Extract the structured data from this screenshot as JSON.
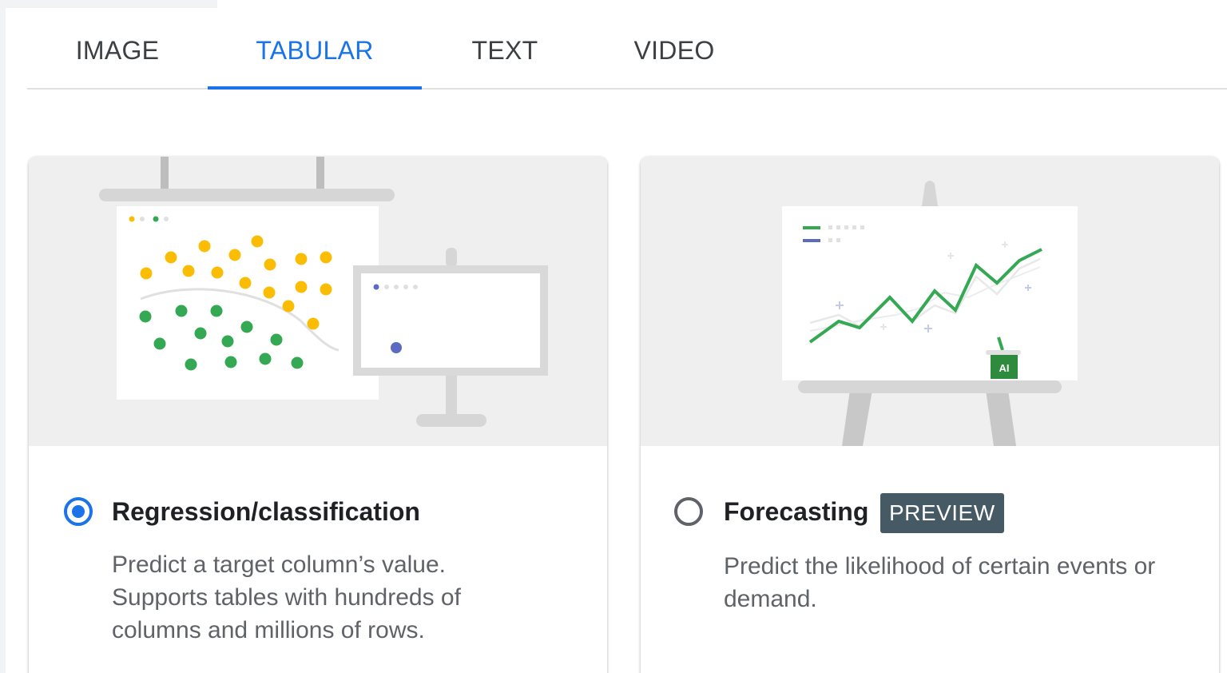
{
  "tabs": [
    {
      "label": "IMAGE"
    },
    {
      "label": "TABULAR",
      "active": true
    },
    {
      "label": "TEXT"
    },
    {
      "label": "VIDEO"
    }
  ],
  "options": [
    {
      "title": "Regression/classification",
      "description": "Predict a target column’s value. Supports tables with hundreds of columns and millions of rows.",
      "selected": true
    },
    {
      "title": "Forecasting",
      "badge": "PREVIEW",
      "description": "Predict the likelihood of certain events or demand.",
      "selected": false,
      "illustration_badge": "AI"
    }
  ],
  "colors": {
    "accent": "#1a73e8",
    "badge_bg": "#455a64",
    "dot_yellow": "#fbbc04",
    "dot_green": "#34a853",
    "dot_blue": "#5c6bc0",
    "line_green": "#34a853"
  }
}
